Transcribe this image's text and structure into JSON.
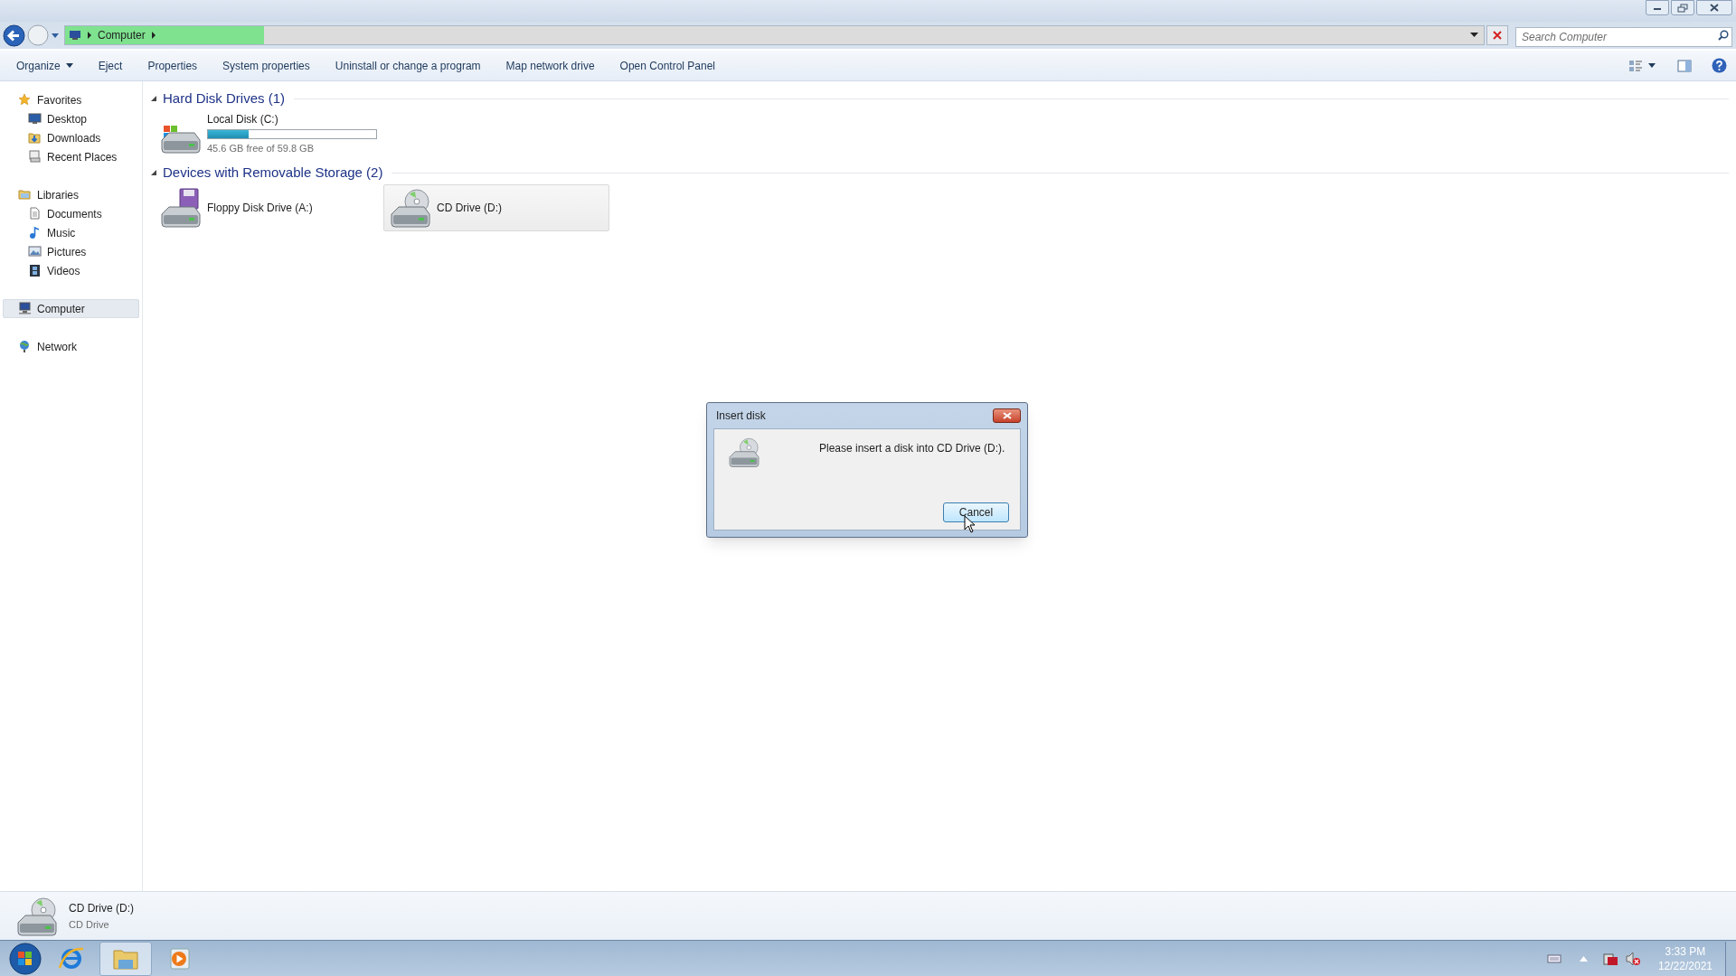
{
  "address_bar": {
    "breadcrumbs": [
      "Computer"
    ],
    "level": 0.14
  },
  "search": {
    "placeholder": "Search Computer"
  },
  "toolbar": {
    "items": [
      {
        "kind": "menu",
        "label": "Organize"
      },
      {
        "kind": "button",
        "label": "Eject"
      },
      {
        "kind": "button",
        "label": "Properties"
      },
      {
        "kind": "button",
        "label": "System properties"
      },
      {
        "kind": "button",
        "label": "Uninstall or change a program"
      },
      {
        "kind": "button",
        "label": "Map network drive"
      },
      {
        "kind": "button",
        "label": "Open Control Panel"
      }
    ]
  },
  "sidebar": {
    "groups": [
      {
        "label": "Favorites",
        "selected": false,
        "children": [
          {
            "label": "Desktop",
            "selected": false
          },
          {
            "label": "Downloads",
            "selected": false
          },
          {
            "label": "Recent Places",
            "selected": false
          }
        ]
      },
      {
        "label": "Libraries",
        "selected": false,
        "children": [
          {
            "label": "Documents",
            "selected": false
          },
          {
            "label": "Music",
            "selected": false
          },
          {
            "label": "Pictures",
            "selected": false
          },
          {
            "label": "Videos",
            "selected": false
          }
        ]
      },
      {
        "label": "Computer",
        "selected": true
      },
      {
        "label": "Network",
        "selected": false
      }
    ]
  },
  "sections": [
    {
      "title": "Hard Disk Drives (1)",
      "expanded": true,
      "items": [
        {
          "kind": "hdd",
          "name": "Local Disk (C:)",
          "level": 0.24,
          "info": "45.6 GB free of 59.8 GB",
          "selected": false
        }
      ]
    },
    {
      "title": "Devices with Removable Storage (2)",
      "expanded": true,
      "items": [
        {
          "kind": "floppy",
          "name": "Floppy Disk Drive (A:)",
          "selected": false
        },
        {
          "kind": "cd",
          "name": "CD Drive (D:)",
          "selected": true
        }
      ]
    }
  ],
  "details_pane": {
    "kind": "cd",
    "name": "CD Drive (D:)",
    "type": "CD Drive"
  },
  "dialog": {
    "title": "Insert disk",
    "message": "Please insert a disk into CD Drive (D:).",
    "buttons": [
      "Cancel"
    ]
  },
  "taskbar": {
    "apps": [
      {
        "selected": false
      },
      {
        "selected": true
      },
      {
        "selected": false
      }
    ]
  },
  "tray": {
    "time": "3:33 PM",
    "date": "12/22/2021"
  }
}
